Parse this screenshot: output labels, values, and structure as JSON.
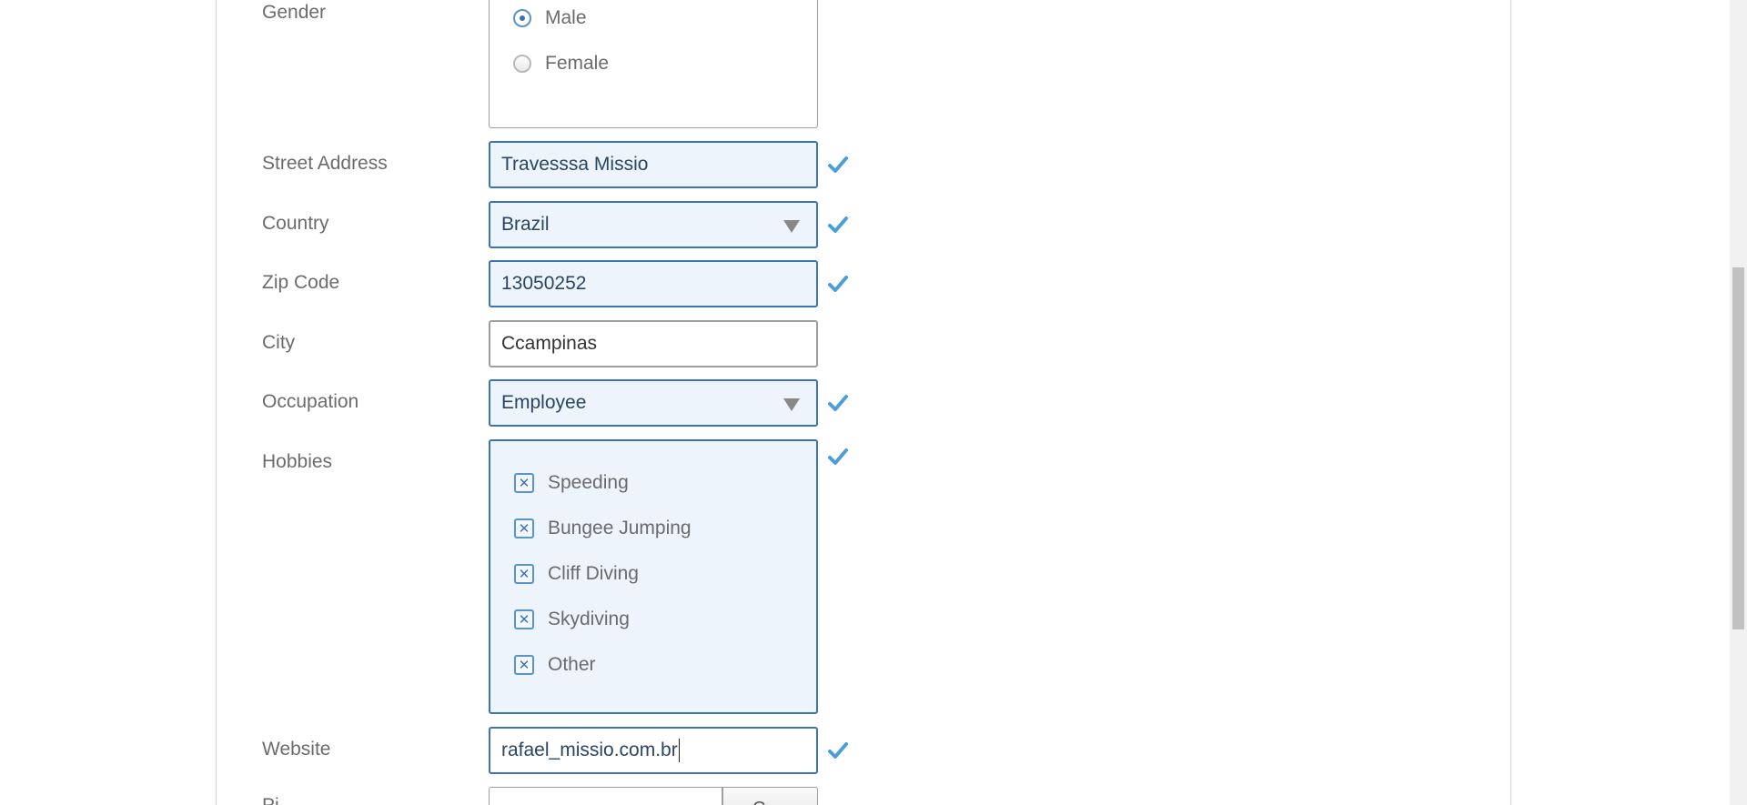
{
  "form": {
    "gender": {
      "label": "Gender",
      "options": [
        {
          "label": "Male",
          "selected": true
        },
        {
          "label": "Female",
          "selected": false
        }
      ]
    },
    "street": {
      "label": "Street Address",
      "value": "Travesssa Missio",
      "valid": true
    },
    "country": {
      "label": "Country",
      "value": "Brazil",
      "valid": true
    },
    "zip": {
      "label": "Zip Code",
      "value": "13050252",
      "valid": true
    },
    "city": {
      "label": "City",
      "value": "Ccampinas",
      "valid": false
    },
    "occupation": {
      "label": "Occupation",
      "value": "Employee",
      "valid": true
    },
    "hobbies": {
      "label": "Hobbies",
      "valid": true,
      "items": [
        {
          "label": "Speeding",
          "checked": true
        },
        {
          "label": "Bungee Jumping",
          "checked": true
        },
        {
          "label": "Cliff Diving",
          "checked": true
        },
        {
          "label": "Skydiving",
          "checked": true
        },
        {
          "label": "Other",
          "checked": true
        }
      ]
    },
    "website": {
      "label": "Website",
      "value": "rafael_missio.com.br",
      "valid": true
    },
    "picture": {
      "label": "Pi",
      "button_label": "C"
    }
  },
  "icons": {
    "valid_check": "checkmark-icon",
    "select_arrow": "triangle-down-icon",
    "checkbox_mark": "✕"
  },
  "colors": {
    "valid_border": "#3b73b5",
    "valid_bg": "#edf4fc",
    "check_color": "#4a9fd8"
  }
}
